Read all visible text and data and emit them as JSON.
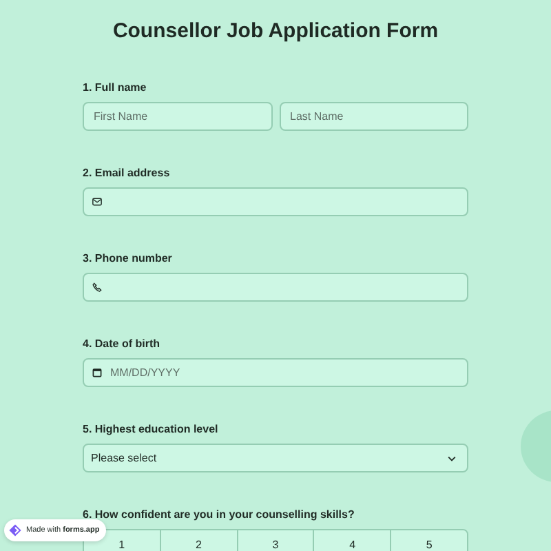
{
  "title": "Counsellor Job Application Form",
  "questions": [
    {
      "kind": "name",
      "label": "1. Full name",
      "placeholders": [
        "First Name",
        "Last Name"
      ]
    },
    {
      "kind": "email",
      "label": "2. Email address"
    },
    {
      "kind": "phone",
      "label": "3. Phone number"
    },
    {
      "kind": "date",
      "label": "4. Date of birth",
      "placeholder": "MM/DD/YYYY"
    },
    {
      "kind": "select",
      "label": "5. Highest education level",
      "value": "Please select"
    },
    {
      "kind": "scale",
      "label": "6. How confident are you in your counselling skills?",
      "options": [
        "1",
        "2",
        "3",
        "4",
        "5"
      ]
    }
  ],
  "badge": {
    "text": "Made with **forms.app**"
  }
}
